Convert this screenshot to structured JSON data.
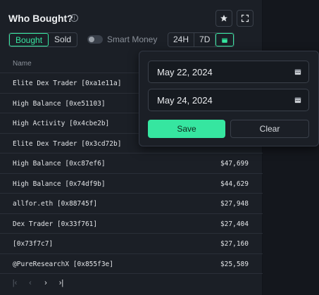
{
  "header": {
    "title": "Who Bought?",
    "info_glyph": "i"
  },
  "filters": {
    "bought_label": "Bought",
    "sold_label": "Sold",
    "smart_money_label": "Smart Money",
    "smart_money_on": false,
    "time_options": [
      "24H",
      "7D"
    ]
  },
  "table": {
    "column_name": "Name",
    "rows": [
      {
        "name": "Elite Dex Trader [0xa1e11a]",
        "value": ""
      },
      {
        "name": "High Balance [0xe51103]",
        "value": ""
      },
      {
        "name": "High Activity [0x4cbe2b]",
        "value": ""
      },
      {
        "name": "Elite Dex Trader [0x3cd72b]",
        "value": ""
      },
      {
        "name": "High Balance [0xc87ef6]",
        "value": "$47,699"
      },
      {
        "name": "High Balance [0x74df9b]",
        "value": "$44,629"
      },
      {
        "name": "allfor.eth [0x88745f]",
        "value": "$27,948"
      },
      {
        "name": "Dex Trader [0x33f761]",
        "value": "$27,404"
      },
      {
        "name": "[0x73f7c7]",
        "value": "$27,160"
      },
      {
        "name": "@PureResearchX [0x855f3e]",
        "value": "$25,589"
      }
    ]
  },
  "pager": {
    "first": "|‹",
    "prev": "‹",
    "next": "›",
    "last": "›|"
  },
  "date_picker": {
    "start_date": "May 22, 2024",
    "end_date": "May 24, 2024",
    "save_label": "Save",
    "clear_label": "Clear"
  },
  "colors": {
    "accent": "#36e6a0",
    "panel": "#1b1f26",
    "background": "#14171d"
  },
  "icons": [
    "info-icon",
    "star-icon",
    "expand-icon",
    "calendar-icon",
    "calendar-input-icon",
    "pager-icons"
  ]
}
